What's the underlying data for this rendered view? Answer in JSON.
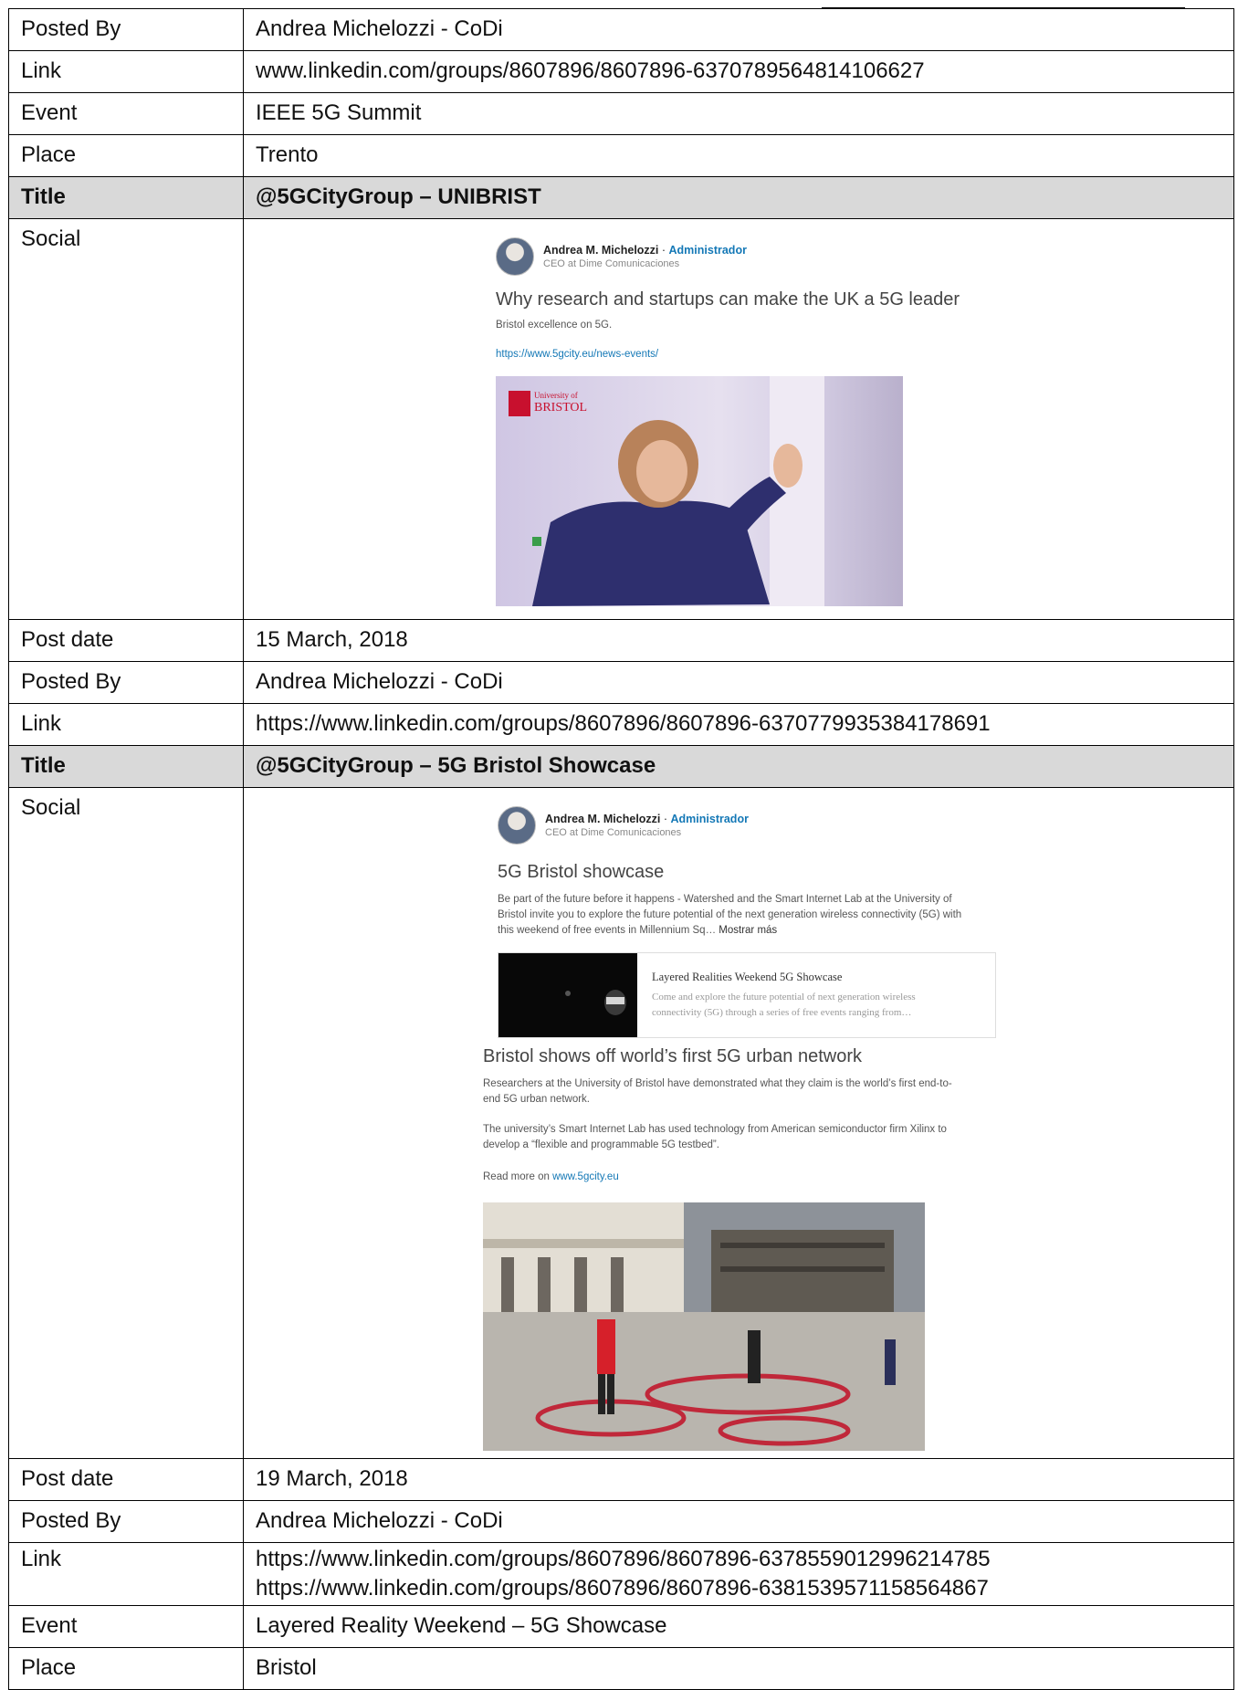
{
  "rows1": [
    {
      "label": "Posted By",
      "value": "Andrea Michelozzi - CoDi"
    },
    {
      "label": "Link",
      "value": "www.linkedin.com/groups/8607896/8607896-6370789564814106627"
    },
    {
      "label": "Event",
      "value": "IEEE 5G Summit"
    },
    {
      "label": "Place",
      "value": "Trento"
    }
  ],
  "post1": {
    "title_label": "Title",
    "title_value": "@5GCityGroup –  UNIBRIST",
    "social_label": "Social",
    "card": {
      "author": "Andrea M. Michelozzi",
      "sep": " · ",
      "role": "Administrador",
      "subtitle": "CEO at Dime Comunicaciones",
      "headline": "Why research and startups can make the UK a 5G leader",
      "text": "Bristol excellence on 5G.",
      "url": "https://www.5gcity.eu/news-events/",
      "logo_top": "University of",
      "logo_bottom": "BRISTOL"
    }
  },
  "rows2": [
    {
      "label": "Post date",
      "value": "15 March, 2018"
    },
    {
      "label": "Posted By",
      "value": "Andrea Michelozzi - CoDi"
    },
    {
      "label": "Link",
      "value": "https://www.linkedin.com/groups/8607896/8607896-6370779935384178691"
    }
  ],
  "post2": {
    "title_label": "Title",
    "title_value": "@5GCityGroup – 5G Bristol Showcase",
    "social_label": "Social",
    "card": {
      "author": "Andrea M. Michelozzi",
      "sep": " · ",
      "role": "Administrador",
      "subtitle": "CEO at Dime Comunicaciones",
      "headline": "5G Bristol showcase",
      "text_l1": "Be part of the future before it happens - Watershed and the Smart Internet Lab at the University of",
      "text_l2": "Bristol invite you to explore the future potential of the next generation wireless connectivity (5G) with",
      "text_l3": "this weekend of free events in Millennium Sq…",
      "more": "Mostrar más",
      "link_title": "Layered Realities Weekend 5G Showcase",
      "link_desc_l1": "Come and explore the future potential of next generation wireless",
      "link_desc_l2": "connectivity (5G) through a series of free events ranging from…"
    },
    "article": {
      "headline": "Bristol shows off world’s first 5G urban network",
      "p1_l1": "Researchers at the University of Bristol have demonstrated what they claim is the world’s first end-to-",
      "p1_l2": "end 5G urban network.",
      "p2_l1": "The university’s Smart Internet Lab has used technology from American semiconductor firm Xilinx to",
      "p2_l2": "develop a “flexible and programmable 5G testbed”.",
      "read_more": "Read more on ",
      "read_more_link": "www.5gcity.eu"
    }
  },
  "rows3": [
    {
      "label": "Post date",
      "value": "19 March, 2018"
    },
    {
      "label": "Posted By",
      "value": "Andrea Michelozzi - CoDi"
    }
  ],
  "links3": {
    "label": "Link",
    "line1": "https://www.linkedin.com/groups/8607896/8607896-6378559012996214785",
    "line2": "https://www.linkedin.com/groups/8607896/8607896-6381539571158564867"
  },
  "rows4": [
    {
      "label": "Event",
      "value": "Layered Reality Weekend – 5G Showcase"
    },
    {
      "label": "Place",
      "value": "Bristol"
    }
  ]
}
